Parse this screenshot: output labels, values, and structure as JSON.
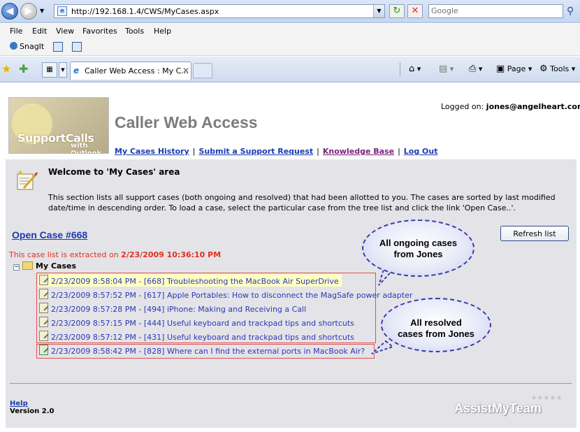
{
  "browser": {
    "url": "http://192.168.1.4/CWS/MyCases.aspx",
    "search_placeholder": "Google",
    "menu": [
      "File",
      "Edit",
      "View",
      "Favorites",
      "Tools",
      "Help"
    ],
    "snagit_label": "SnagIt",
    "tab_title": "Caller Web Access : My C...",
    "page_label": "Page",
    "tools_label": "Tools"
  },
  "header": {
    "logo_text": "SupportCalls",
    "logo_sub": "with Outlook",
    "app_title": "Caller Web Access",
    "logged_on_label": "Logged on:",
    "logged_on_user": "jones@angelheart.com",
    "nav_links": [
      "My Cases History",
      "Submit a Support Request",
      "Knowledge Base",
      "Log Out"
    ]
  },
  "main": {
    "welcome_title": "Welcome to 'My Cases' area",
    "description": "This section lists all support cases (both ongoing and resolved) that had been allotted to you. The cases are sorted by last modified date/time in descending order. To load a case, select the particular case from the tree list and click the link 'Open Case..'.",
    "open_case_link": "Open Case #668",
    "refresh_button": "Refresh list",
    "extracted_label": "This case list is extracted on",
    "extracted_time": "2/23/2009 10:36:10 PM",
    "tree_root": "My Cases",
    "ongoing_cases": [
      "2/23/2009 8:58:04 PM - [668] Troubleshooting the MacBook Air SuperDrive",
      "2/23/2009 8:57:52 PM - [617] Apple Portables: How to disconnect the MagSafe power adapter",
      "2/23/2009 8:57:28 PM - [494] iPhone: Making and Receiving a Call",
      "2/23/2009 8:57:15 PM - [444] Useful keyboard and trackpad tips and shortcuts",
      "2/23/2009 8:57:12 PM - [431] Useful keyboard and trackpad tips and shortcuts"
    ],
    "resolved_cases": [
      "2/23/2009 8:58:42 PM - [828] Where can I find the external ports in MacBook Air?"
    ],
    "bubble_ongoing_1": "All ongoing cases",
    "bubble_ongoing_2": "from Jones",
    "bubble_resolved_1": "All resolved",
    "bubble_resolved_2": "cases from Jones"
  },
  "footer": {
    "help_link": "Help",
    "version": "Version 2.0",
    "brand": "AssistMyTeam"
  },
  "colors": {
    "link": "#1a3cb0",
    "extract_text": "#e0301e",
    "panel_bg": "#e4e3e8",
    "case_box_border": "#e05050",
    "bubble_border": "#3a3aa8"
  }
}
